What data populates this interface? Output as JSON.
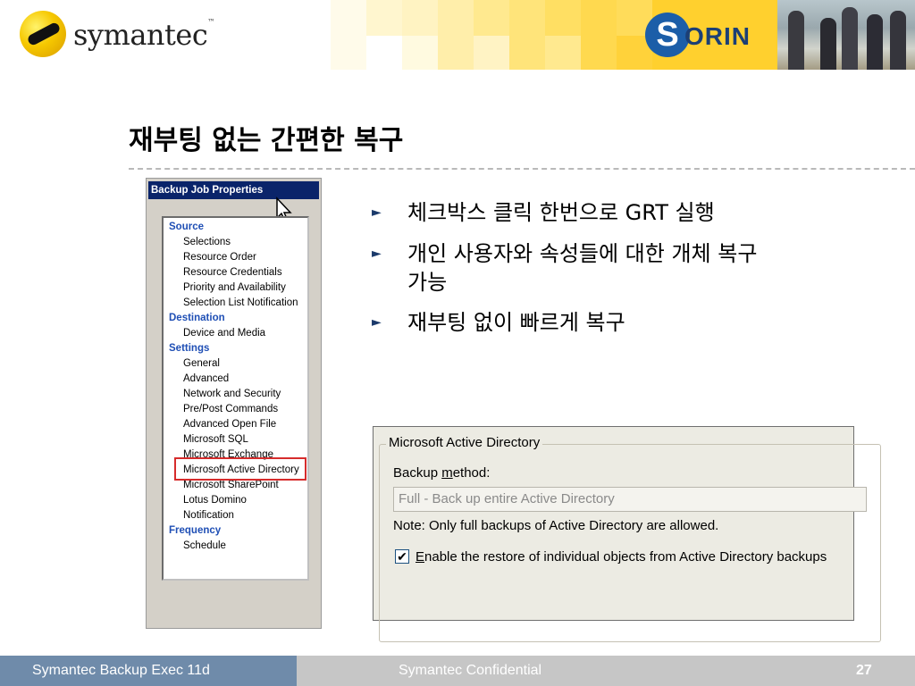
{
  "header": {
    "brand_name": "symantec",
    "brand_tm": "™",
    "partner_logo_letter": "S",
    "partner_logo_text": "ORIN"
  },
  "slide": {
    "title": "재부팅 없는 간편한 복구",
    "bullets": [
      "체크박스 클릭 한번으로 GRT 실행",
      "개인 사용자와 속성들에 대한 개체 복구",
      "가능",
      "재부팅 없이 빠르게 복구"
    ]
  },
  "backup_job_properties": {
    "title": "Backup Job Properties",
    "tree": [
      {
        "label": "Source",
        "type": "category"
      },
      {
        "label": "Selections",
        "type": "item"
      },
      {
        "label": "Resource Order",
        "type": "item"
      },
      {
        "label": "Resource Credentials",
        "type": "item"
      },
      {
        "label": "Priority and Availability",
        "type": "item"
      },
      {
        "label": "Selection List Notification",
        "type": "item"
      },
      {
        "label": "Destination",
        "type": "category"
      },
      {
        "label": "Device and Media",
        "type": "item"
      },
      {
        "label": "Settings",
        "type": "category"
      },
      {
        "label": "General",
        "type": "item"
      },
      {
        "label": "Advanced",
        "type": "item"
      },
      {
        "label": "Network and Security",
        "type": "item"
      },
      {
        "label": "Pre/Post Commands",
        "type": "item"
      },
      {
        "label": "Advanced Open File",
        "type": "item"
      },
      {
        "label": "Microsoft SQL",
        "type": "item"
      },
      {
        "label": "Microsoft Exchange",
        "type": "item"
      },
      {
        "label": "Microsoft Active Directory",
        "type": "item",
        "highlighted": true
      },
      {
        "label": "Microsoft SharePoint",
        "type": "item"
      },
      {
        "label": "Lotus Domino",
        "type": "item"
      },
      {
        "label": "Notification",
        "type": "item"
      },
      {
        "label": "Frequency",
        "type": "category"
      },
      {
        "label": "Schedule",
        "type": "item"
      }
    ]
  },
  "active_directory_panel": {
    "group_title": "Microsoft Active Directory",
    "backup_method_label_pre": "Backup ",
    "backup_method_label_key": "m",
    "backup_method_label_post": "ethod:",
    "backup_method_value": "Full - Back up entire Active Directory",
    "note": "Note: Only full backups of Active Directory are allowed.",
    "checkbox_checked": true,
    "checkbox_mark": "✔",
    "checkbox_label_key": "E",
    "checkbox_label_rest": "nable the restore of individual objects from Active Directory backups"
  },
  "footer": {
    "product": "Symantec Backup Exec 11d",
    "confidential": "Symantec Confidential",
    "page_number": "27"
  },
  "colors": {
    "footer_left": "#6f8baa",
    "footer_bar": "#c6c6c6",
    "title_bar": "#0a246a",
    "category_text": "#1f4fb5",
    "highlight_border": "#d62c2c"
  }
}
